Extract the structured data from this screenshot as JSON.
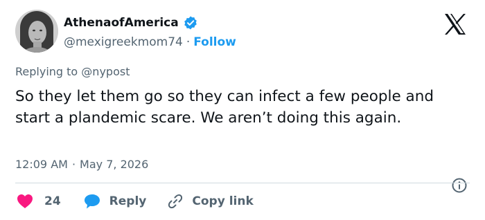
{
  "author": {
    "display_name": "AthenaofAmerica",
    "handle": "@mexigreekmom74",
    "separator": "·",
    "follow_label": "Follow"
  },
  "reply_context": {
    "prefix": "Replying to",
    "mention": "@nypost"
  },
  "tweet": {
    "text": "So they let them go so they can infect a few people and start a plandemic scare. We aren’t doing this again.",
    "time": "12:09 AM",
    "separator": "·",
    "date": "May 7, 2026"
  },
  "actions": {
    "like_count": "24",
    "reply_label": "Reply",
    "copy_link_label": "Copy link"
  },
  "icons": {
    "logo": "x-logo",
    "verified": "verified-badge-icon",
    "info": "info-icon",
    "like": "heart-icon",
    "reply": "speech-bubble-icon",
    "copy": "link-icon"
  },
  "colors": {
    "accent": "#1d9bf0",
    "like": "#f91880",
    "muted_text": "#536471",
    "text": "#0f1419",
    "divider": "#cfd9de"
  }
}
